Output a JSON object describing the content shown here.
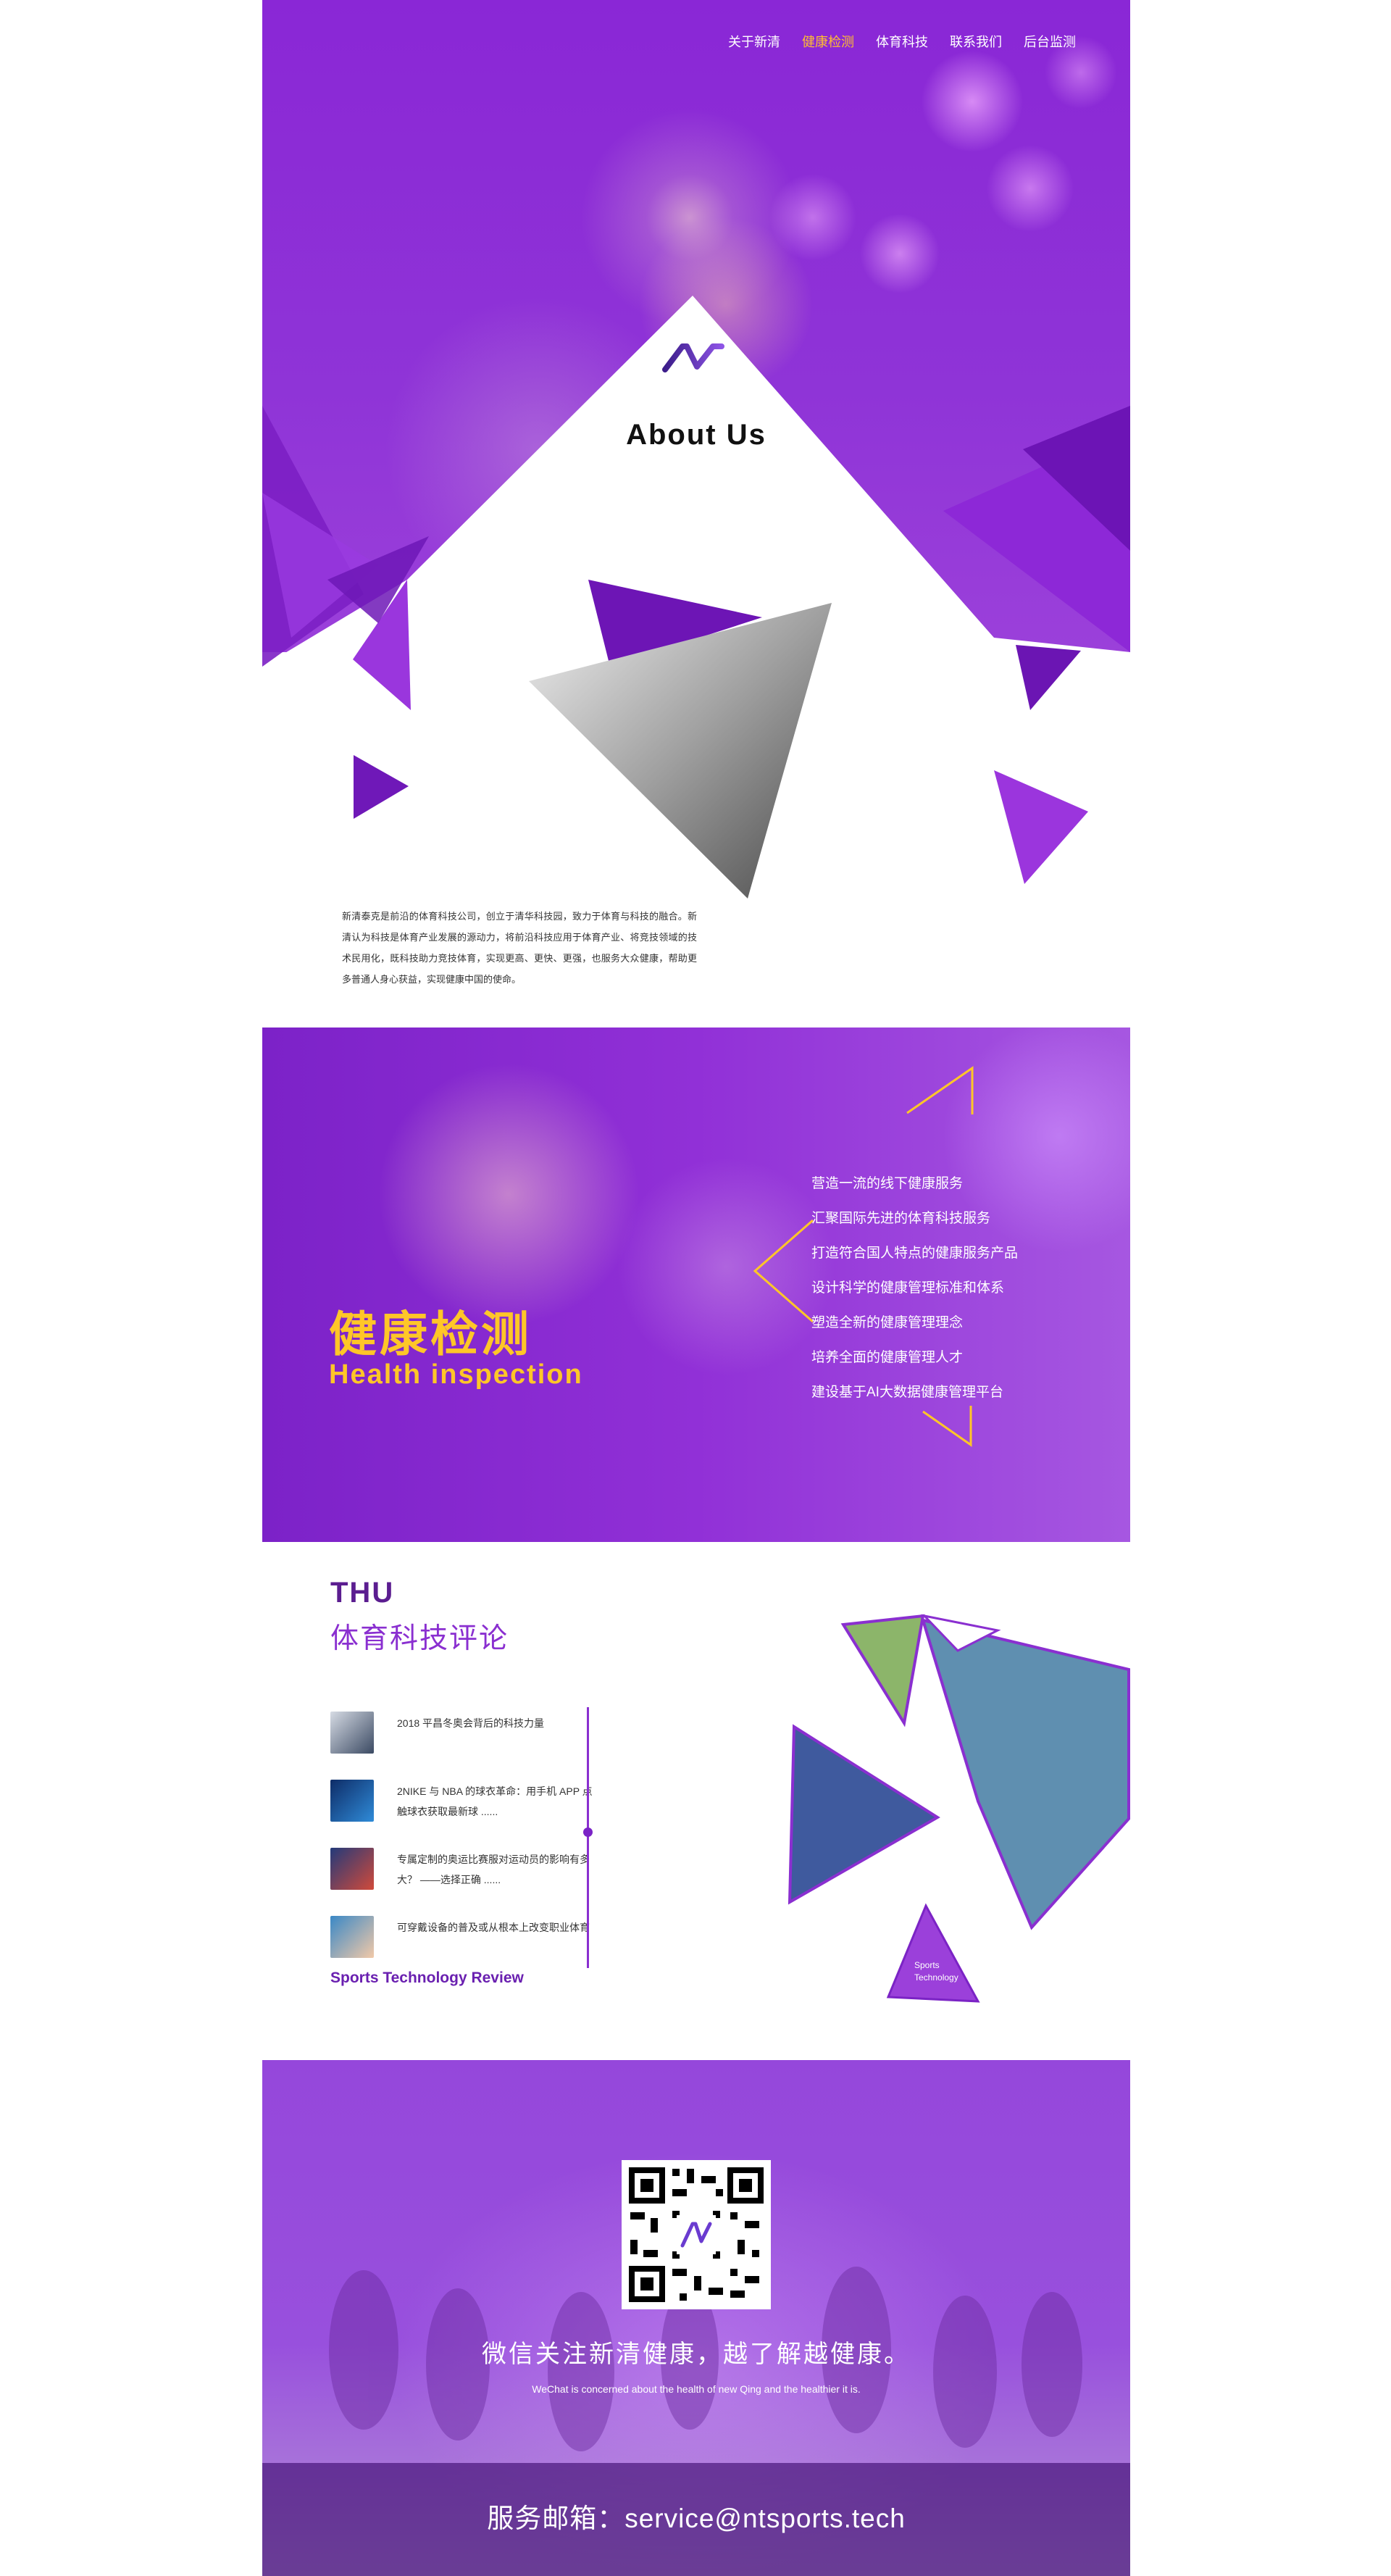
{
  "nav": {
    "items": [
      "关于新清",
      "健康检测",
      "体育科技",
      "联系我们",
      "后台监测"
    ],
    "active": "健康检测"
  },
  "about": {
    "title": "About Us",
    "text": "新清泰克是前沿的体育科技公司，创立于清华科技园，致力于体育与科技的融合。新清认为科技是体育产业发展的源动力，将前沿科技应用于体育产业、将竞技领域的技术民用化，既科技助力竞技体育，实现更高、更快、更强，也服务大众健康，帮助更多普通人身心获益，实现健康中国的使命。"
  },
  "health": {
    "title_cn": "健康检测",
    "title_en": "Health inspection",
    "items": [
      "营造一流的线下健康服务",
      "汇聚国际先进的体育科技服务",
      "打造符合国人特点的健康服务产品",
      "设计科学的健康管理标准和体系",
      "塑造全新的健康管理理念",
      "培养全面的健康管理人才",
      "建设基于AI大数据健康管理平台"
    ]
  },
  "review": {
    "thu": "THU",
    "title_cn": "体育科技评论",
    "articles": [
      {
        "title": "2018 平昌冬奥会背后的科技力量"
      },
      {
        "title": "2NIKE 与 NBA 的球衣革命：用手机 APP 点触球衣获取最新球 ......"
      },
      {
        "title": "专属定制的奥运比赛服对运动员的影响有多大？ ——选择正确 ......"
      },
      {
        "title": "可穿戴设备的普及或从根本上改变职业体育"
      }
    ],
    "title_en": "Sports Technology Review",
    "triangle_label_1": "Sports",
    "triangle_label_2": "Technology"
  },
  "footer": {
    "wechat_cn": "微信关注新清健康，越了解越健康。",
    "wechat_en": "WeChat is concerned about the health of new Qing and the healthier it is.",
    "service": "服务邮箱：service@ntsports.tech"
  },
  "colors": {
    "purple": "#8a2fd0",
    "dark_purple": "#5b1d90",
    "yellow": "#ffc628",
    "nav_active": "#ffbd31"
  }
}
